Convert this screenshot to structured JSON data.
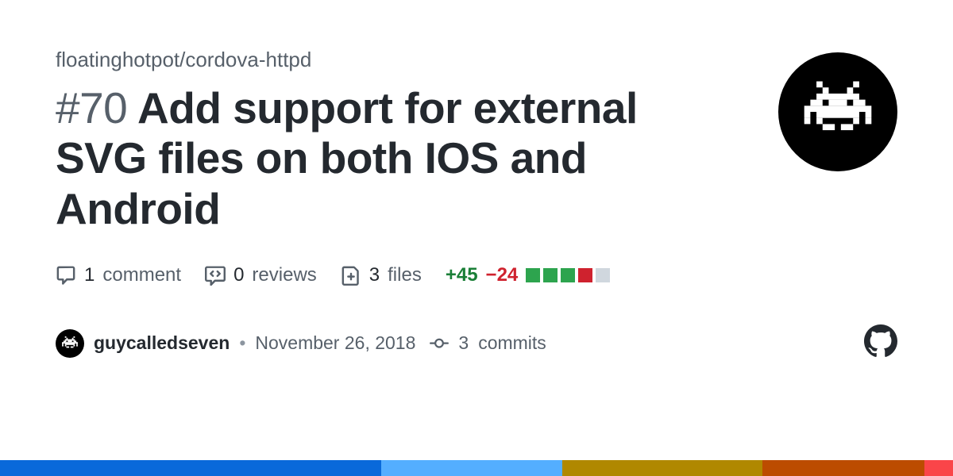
{
  "repo": "floatinghotpot/cordova-httpd",
  "issue_hash": "#",
  "issue_number": "70",
  "title": "Add support for external SVG files on both IOS and Android",
  "stats": {
    "comments_count": "1",
    "comments_label": "comment",
    "reviews_count": "0",
    "reviews_label": "reviews",
    "files_count": "3",
    "files_label": "files",
    "additions": "+45",
    "deletions": "−24"
  },
  "author": "guycalledseven",
  "date": "November 26, 2018",
  "commits_count": "3",
  "commits_label": "commits",
  "bottom_bar": [
    {
      "color": "#0969da",
      "width": "40%"
    },
    {
      "color": "#54aeff",
      "width": "19%"
    },
    {
      "color": "#b08800",
      "width": "21%"
    },
    {
      "color": "#bc4c00",
      "width": "17%"
    },
    {
      "color": "#fa4549",
      "width": "3%"
    }
  ],
  "diff_squares": [
    "g",
    "g",
    "g",
    "r",
    "n"
  ]
}
